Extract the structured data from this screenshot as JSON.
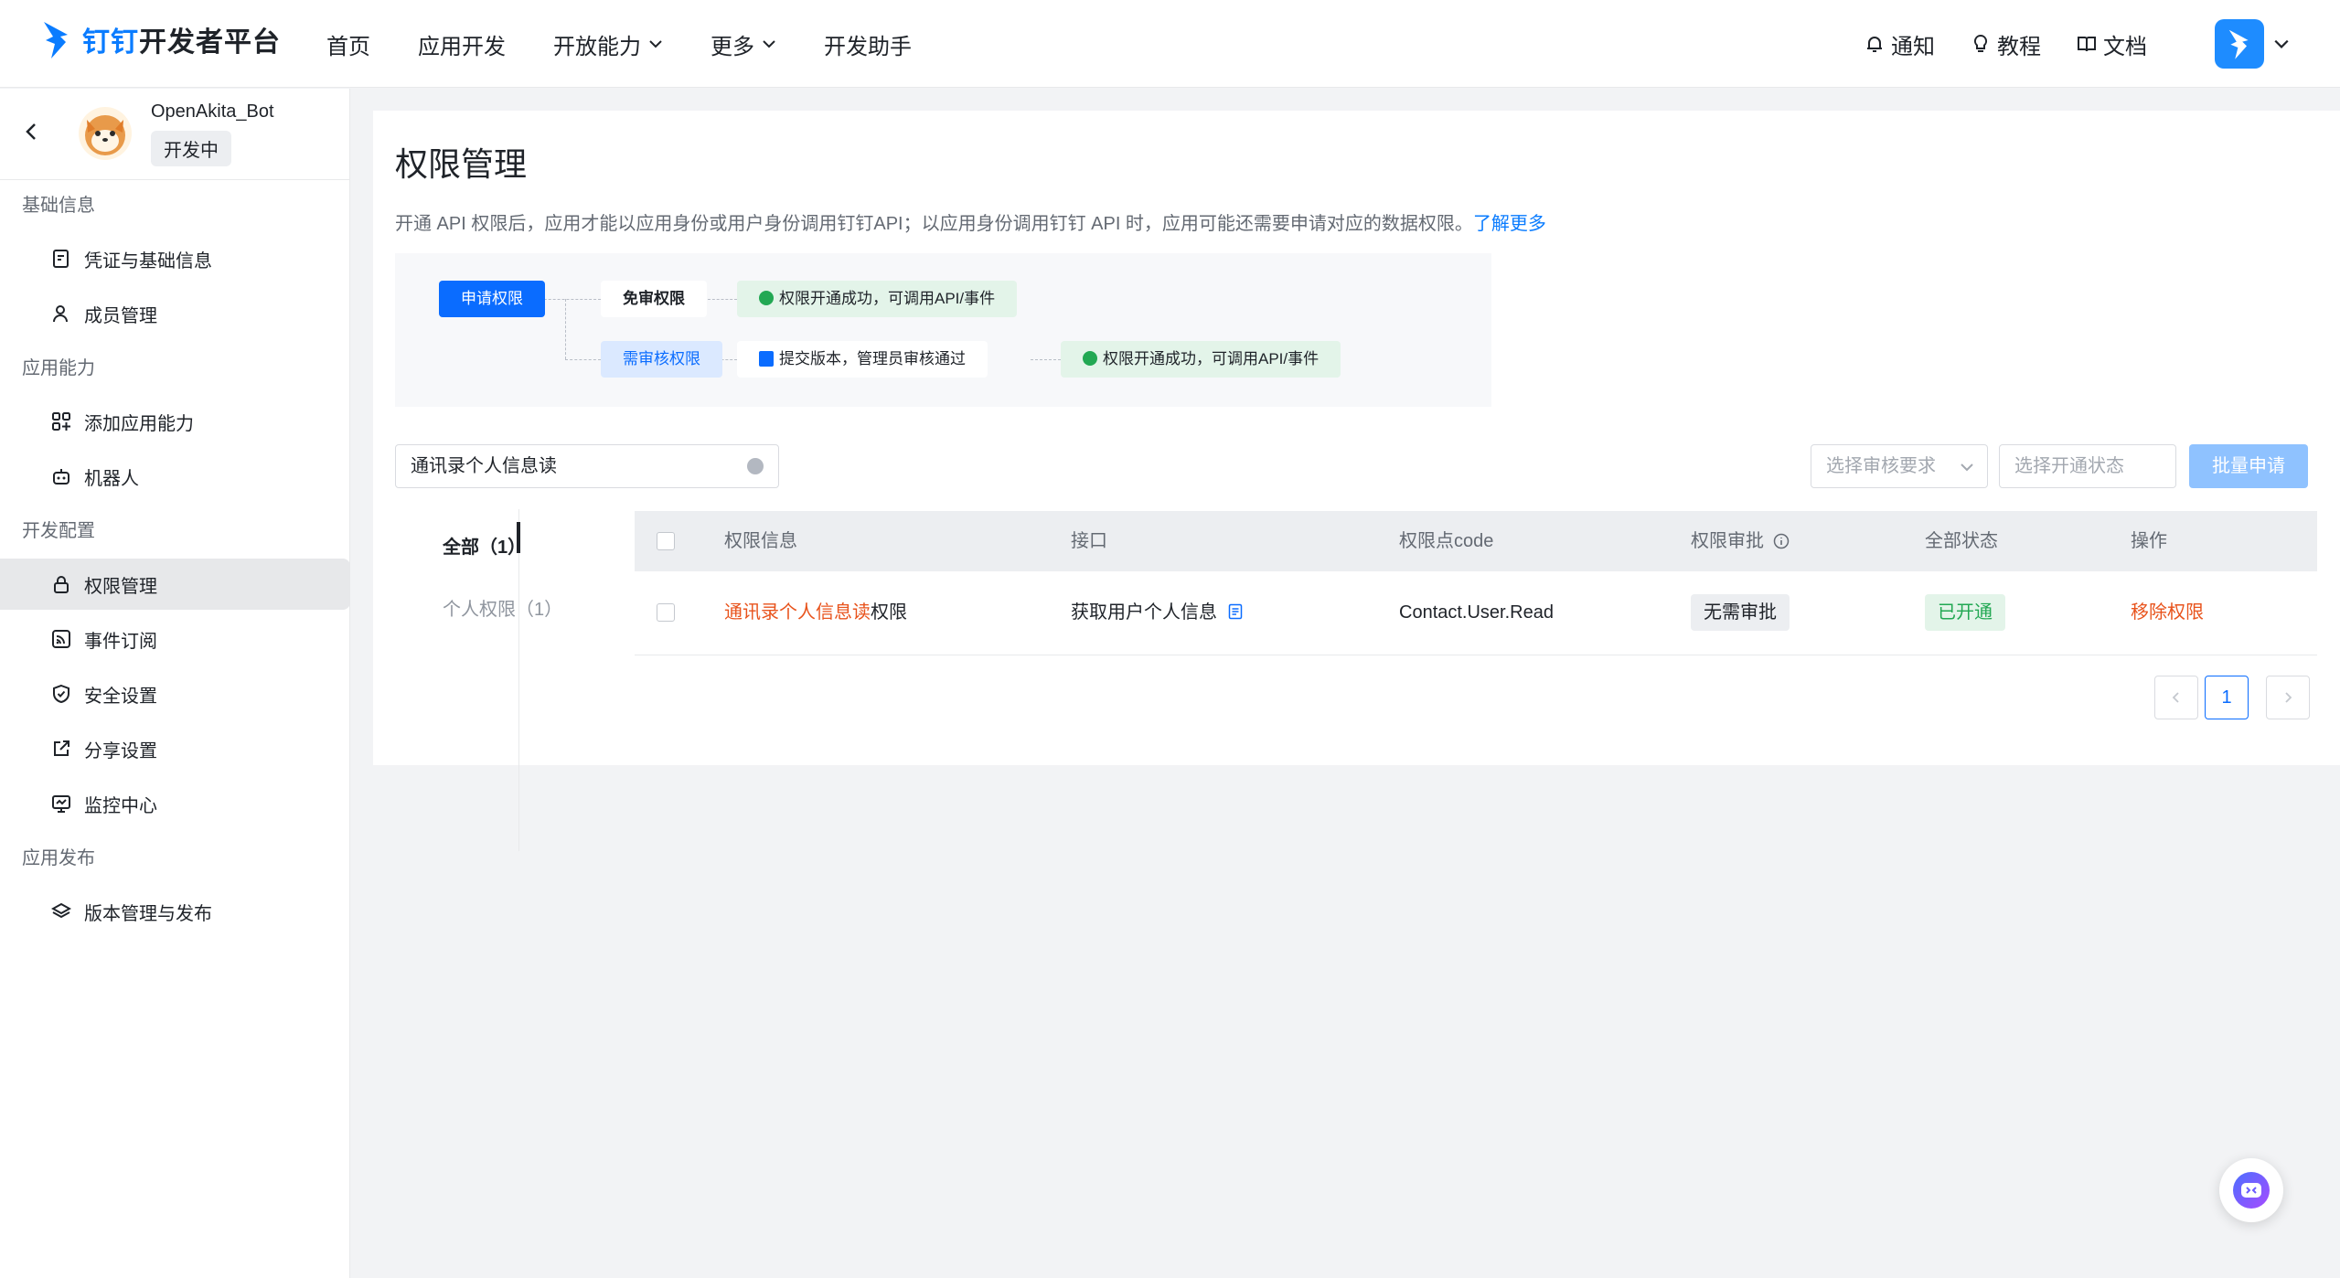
{
  "brand": {
    "logo_blue": "钉钉",
    "logo_black": "开发者平台",
    "color": "#0a7cff"
  },
  "nav": {
    "items": [
      {
        "label": "首页",
        "dropdown": false
      },
      {
        "label": "应用开发",
        "dropdown": false
      },
      {
        "label": "开放能力",
        "dropdown": true
      },
      {
        "label": "更多",
        "dropdown": true
      },
      {
        "label": "开发助手",
        "dropdown": false
      }
    ]
  },
  "tools": {
    "notify": "通知",
    "tutorial": "教程",
    "docs": "文档"
  },
  "app": {
    "name": "OpenAkita_Bot",
    "status": "开发中"
  },
  "sidebar": {
    "groups": [
      {
        "title": "基础信息",
        "items": [
          {
            "label": "凭证与基础信息",
            "icon": "credential-icon"
          },
          {
            "label": "成员管理",
            "icon": "member-icon"
          }
        ]
      },
      {
        "title": "应用能力",
        "items": [
          {
            "label": "添加应用能力",
            "icon": "apps-grid-icon"
          },
          {
            "label": "机器人",
            "icon": "robot-icon"
          }
        ]
      },
      {
        "title": "开发配置",
        "items": [
          {
            "label": "权限管理",
            "icon": "lock-icon",
            "active": true
          },
          {
            "label": "事件订阅",
            "icon": "rss-icon"
          },
          {
            "label": "安全设置",
            "icon": "shield-icon"
          },
          {
            "label": "分享设置",
            "icon": "share-icon"
          },
          {
            "label": "监控中心",
            "icon": "monitor-icon"
          }
        ]
      },
      {
        "title": "应用发布",
        "items": [
          {
            "label": "版本管理与发布",
            "icon": "layers-icon"
          }
        ]
      }
    ]
  },
  "main": {
    "title": "权限管理",
    "description": "开通 API 权限后，应用才能以应用身份或用户身份调用钉钉API；以应用身份调用钉钉 API 时，应用可能还需要申请对应的数据权限。",
    "learn_more": "了解更多",
    "flow": {
      "apply": "申请权限",
      "free": "免审权限",
      "ok1": "权限开通成功，可调用API/事件",
      "review": "需审核权限",
      "submit": "提交版本，管理员审核通过",
      "ok2": "权限开通成功，可调用API/事件"
    },
    "search": {
      "value": "通讯录个人信息读"
    },
    "filters": {
      "review": "选择审核要求",
      "status": "选择开通状态",
      "batch": "批量申请"
    },
    "tabs": [
      {
        "label": "全部（1）"
      },
      {
        "label": "个人权限（1）"
      }
    ],
    "table": {
      "headers": {
        "info": "权限信息",
        "api": "接口",
        "code": "权限点code",
        "approval": "权限审批",
        "status": "全部状态",
        "action": "操作"
      },
      "rows": [
        {
          "name_highlight": "通讯录个人信息读",
          "name_suffix": "权限",
          "api": "获取用户个人信息",
          "code": "Contact.User.Read",
          "approval": "无需审批",
          "status": "已开通",
          "action": "移除权限"
        }
      ]
    },
    "pagination": {
      "current": "1"
    }
  }
}
